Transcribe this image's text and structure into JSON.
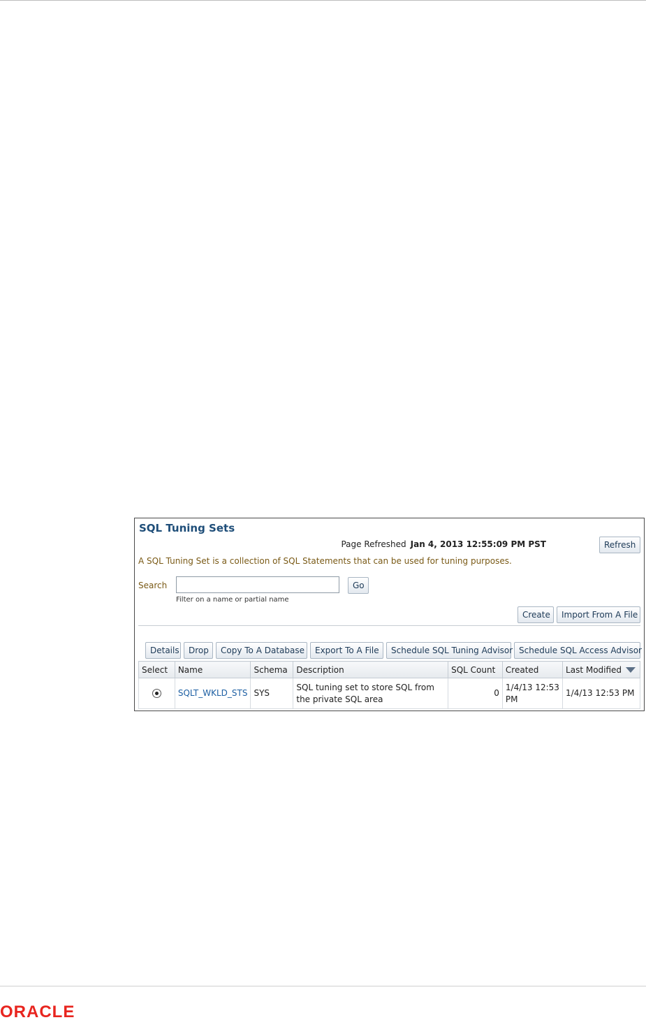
{
  "panel": {
    "title": "SQL Tuning Sets",
    "refresh_label": "Page Refreshed",
    "refresh_timestamp": "Jan 4, 2013 12:55:09 PM PST",
    "refresh_button": "Refresh",
    "description": "A SQL Tuning Set is a collection of SQL Statements that can be used for tuning purposes.",
    "search": {
      "label": "Search",
      "value": "",
      "go_button": "Go",
      "hint": "Filter on a name or partial name"
    },
    "top_actions": {
      "create": "Create",
      "import": "Import From A File"
    },
    "row_actions": {
      "details": "Details",
      "drop": "Drop",
      "copy": "Copy To A Database",
      "export": "Export To A File",
      "tuning_advisor": "Schedule SQL Tuning Advisor",
      "access_advisor": "Schedule SQL Access Advisor"
    },
    "table": {
      "headers": {
        "select": "Select",
        "name": "Name",
        "schema": "Schema",
        "description": "Description",
        "sql_count": "SQL Count",
        "created": "Created",
        "last_modified": "Last Modified"
      },
      "rows": [
        {
          "selected": true,
          "name": "SQLT_WKLD_STS",
          "schema": "SYS",
          "description": "SQL tuning set to store SQL from the private SQL area",
          "sql_count": "0",
          "created": "1/4/13 12:53 PM",
          "last_modified": "1/4/13 12:53 PM"
        }
      ]
    }
  },
  "footer": {
    "logo_text": "ORACLE",
    "logo_color": "#e8251f"
  }
}
